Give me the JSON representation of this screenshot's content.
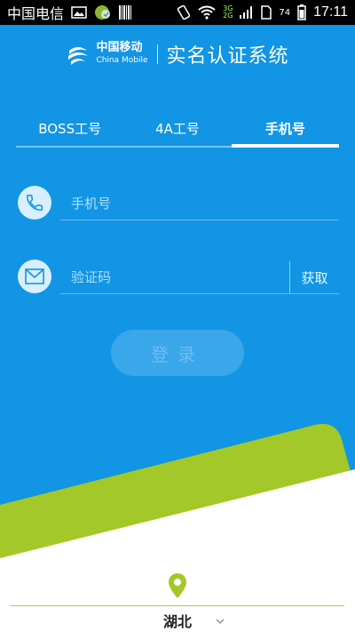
{
  "status_bar": {
    "carrier": "中国电信",
    "network_top": "3G",
    "network_bottom": "2G",
    "battery": "74",
    "time": "17:11"
  },
  "header": {
    "brand_cn": "中国移动",
    "brand_en": "China Mobile",
    "title": "实名认证系统"
  },
  "tabs": [
    {
      "label": "BOSS工号",
      "active": false
    },
    {
      "label": "4A工号",
      "active": false
    },
    {
      "label": "手机号",
      "active": true
    }
  ],
  "form": {
    "phone_placeholder": "手机号",
    "code_placeholder": "验证码",
    "get_code_label": "获取",
    "login_label": "登录"
  },
  "region": {
    "selected": "湖北"
  },
  "colors": {
    "primary_blue": "#1195e4",
    "green": "#a3c829",
    "login_bg": "#3aa7ea"
  },
  "icons": {
    "phone": "phone-icon",
    "mail": "mail-icon",
    "pin": "location-pin-icon"
  }
}
